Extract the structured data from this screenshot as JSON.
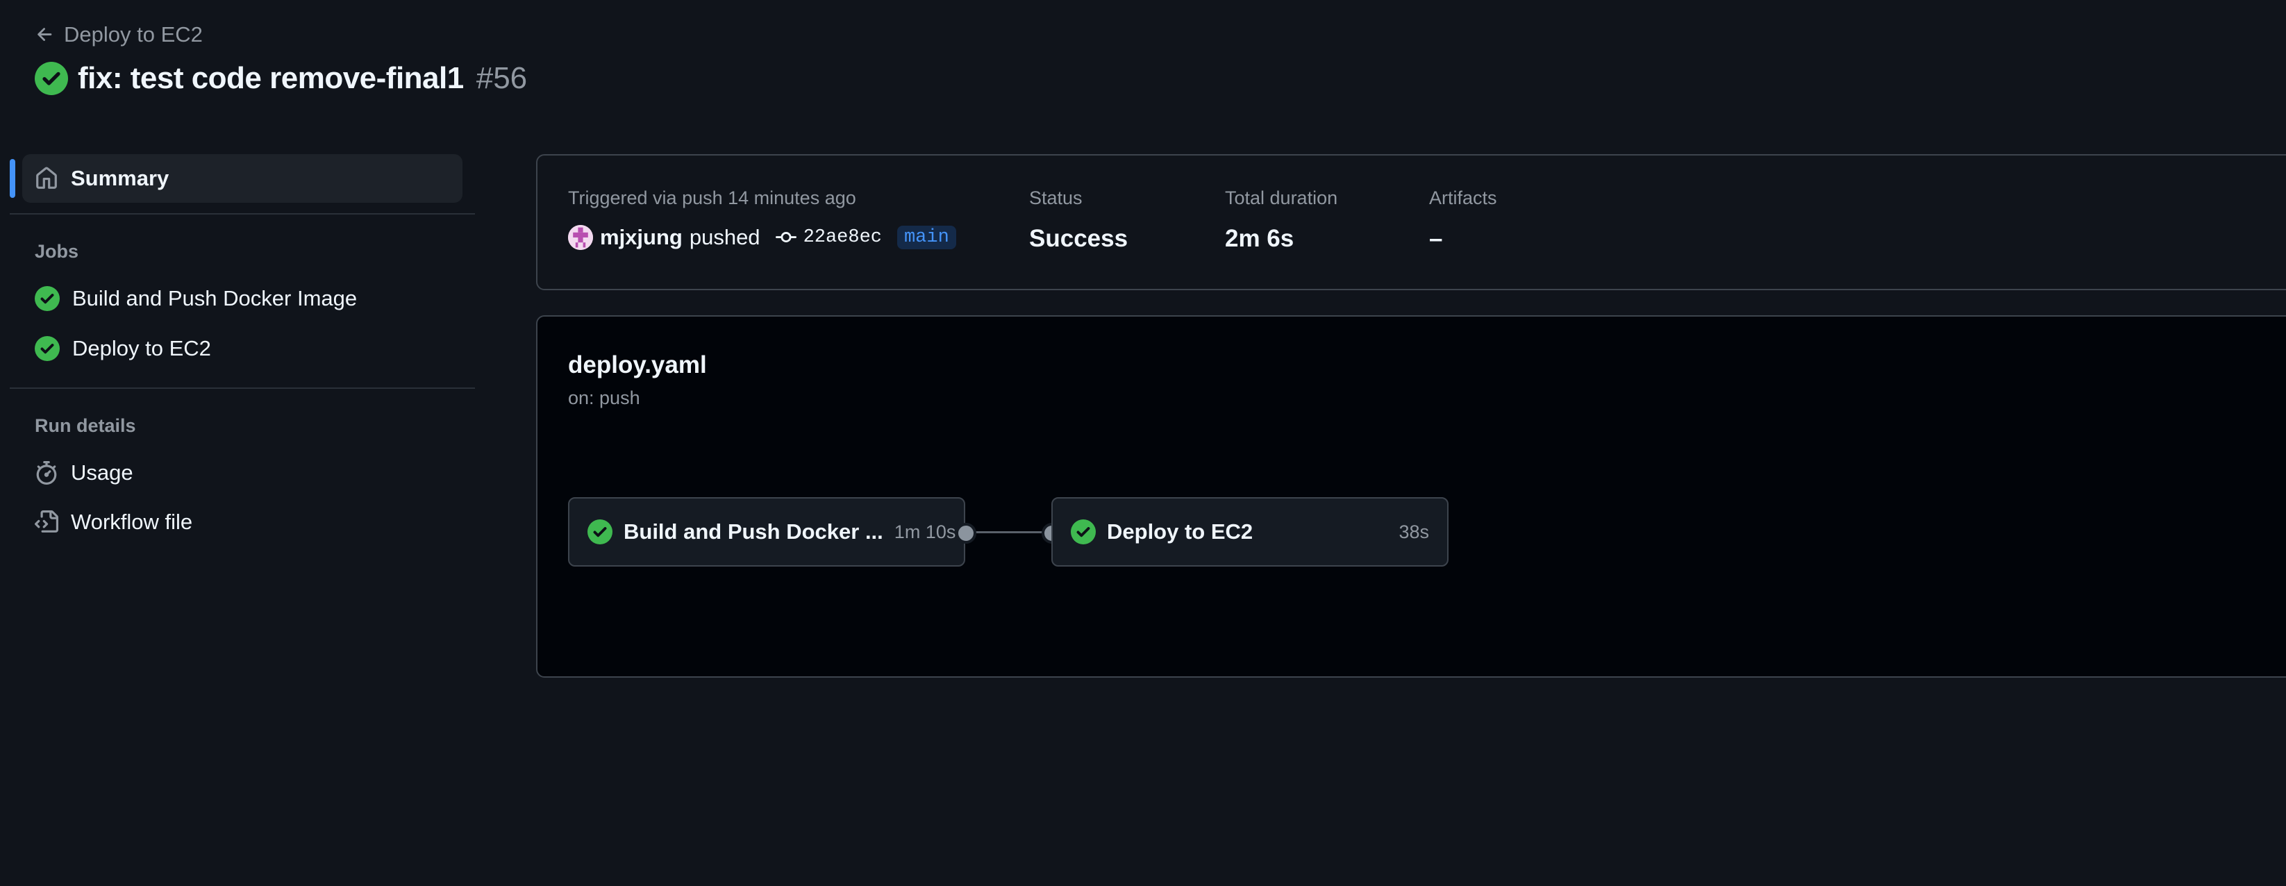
{
  "header": {
    "back_label": "Deploy to EC2",
    "run_title": "fix: test code remove-final1",
    "run_number": "#56"
  },
  "sidebar": {
    "summary_label": "Summary",
    "jobs_heading": "Jobs",
    "jobs": [
      {
        "label": "Build and Push Docker Image",
        "status": "success"
      },
      {
        "label": "Deploy to EC2",
        "status": "success"
      }
    ],
    "run_details_heading": "Run details",
    "details": [
      {
        "label": "Usage",
        "icon": "stopwatch-icon"
      },
      {
        "label": "Workflow file",
        "icon": "file-code-icon"
      }
    ]
  },
  "summary": {
    "triggered_text": "Triggered via push 14 minutes ago",
    "actor": "mjxjung",
    "action": "pushed",
    "commit_sha": "22ae8ec",
    "branch": "main",
    "status_label": "Status",
    "status_value": "Success",
    "duration_label": "Total duration",
    "duration_value": "2m 6s",
    "artifacts_label": "Artifacts",
    "artifacts_value": "–"
  },
  "workflow": {
    "name": "deploy.yaml",
    "trigger": "on: push",
    "jobs": [
      {
        "label": "Build and Push Docker ...",
        "duration": "1m 10s"
      },
      {
        "label": "Deploy to EC2",
        "duration": "38s"
      }
    ]
  },
  "colors": {
    "background": "#10141b",
    "success": "#3fb950",
    "accent": "#4493f8",
    "muted_text": "#9198a1"
  }
}
